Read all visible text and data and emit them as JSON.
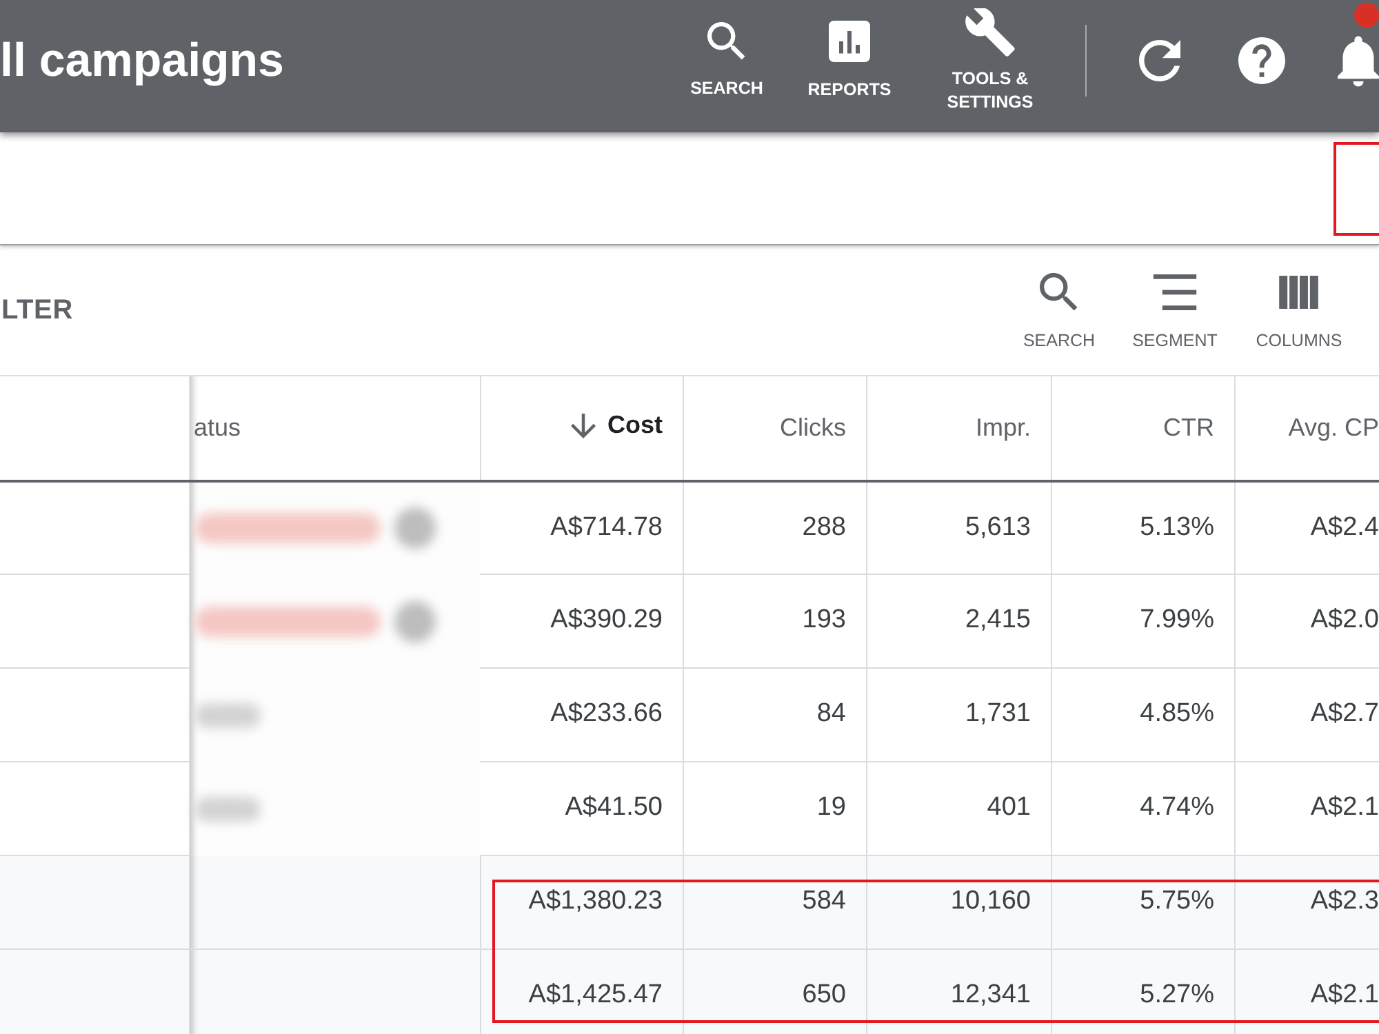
{
  "header": {
    "title": "ll campaigns",
    "nav": [
      {
        "kind": "search",
        "label": "SEARCH"
      },
      {
        "kind": "reports",
        "label": "REPORTS"
      },
      {
        "kind": "tools",
        "label": "TOOLS & SETTINGS"
      }
    ],
    "notification_badge": true
  },
  "filter_bar": {
    "highlighted": true
  },
  "toolbar": {
    "filter_label": "LTER",
    "tools": [
      {
        "kind": "search",
        "label": "SEARCH"
      },
      {
        "kind": "segment",
        "label": "SEGMENT"
      },
      {
        "kind": "columns",
        "label": "COLUMNS"
      }
    ]
  },
  "table": {
    "status_column_label": "atus",
    "columns": [
      {
        "label": "Cost",
        "sorted": true
      },
      {
        "label": "Clicks",
        "sorted": false
      },
      {
        "label": "Impr.",
        "sorted": false
      },
      {
        "label": "CTR",
        "sorted": false
      },
      {
        "label": "Avg. CP",
        "sorted": false
      }
    ],
    "rows": [
      {
        "kind": "campaign",
        "blur": {
          "color": "#f4c7c3",
          "wide": true
        },
        "cells": [
          "A$714.78",
          "288",
          "5,613",
          "5.13%",
          "A$2.4"
        ]
      },
      {
        "kind": "campaign",
        "blur": {
          "color": "#f4c7c3",
          "wide": true
        },
        "cells": [
          "A$390.29",
          "193",
          "2,415",
          "7.99%",
          "A$2.0"
        ]
      },
      {
        "kind": "campaign",
        "blur": {
          "color": "#d3d3d3",
          "wide": false
        },
        "cells": [
          "A$233.66",
          "84",
          "1,731",
          "4.85%",
          "A$2.7"
        ]
      },
      {
        "kind": "campaign",
        "blur": {
          "color": "#d3d3d3",
          "wide": false
        },
        "cells": [
          "A$41.50",
          "19",
          "401",
          "4.74%",
          "A$2.1"
        ]
      },
      {
        "kind": "total",
        "cells": [
          "A$1,380.23",
          "584",
          "10,160",
          "5.75%",
          "A$2.3"
        ]
      },
      {
        "kind": "total",
        "cells": [
          "A$1,425.47",
          "650",
          "12,341",
          "5.27%",
          "A$2.1"
        ]
      }
    ],
    "totals_highlighted": true
  }
}
